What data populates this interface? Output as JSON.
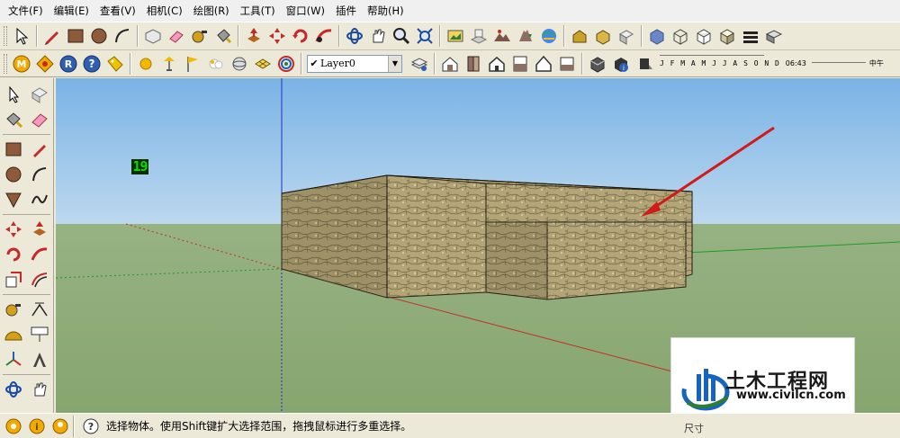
{
  "menu": [
    "文件(F)",
    "编辑(E)",
    "查看(V)",
    "相机(C)",
    "绘图(R)",
    "工具(T)",
    "窗口(W)",
    "插件",
    "帮助(H)"
  ],
  "layers": {
    "check": "✔",
    "current": "Layer0"
  },
  "shadow": {
    "months": "J F M A M J J A S O N D",
    "time": "06:43",
    "noon": "中午"
  },
  "counter": "19",
  "status": {
    "hint": "选择物体。使用Shift键扩大选择范围，拖拽鼠标进行多重选择。",
    "measure_label": "尺寸"
  },
  "watermark": {
    "title": "土木工程网",
    "url": "www.civilcn.com"
  },
  "colors": {
    "sky": "#8fbfe5",
    "ground": "#8eab78",
    "stone": "#b2a376",
    "arrow": "#d11a1a",
    "axis_red": "#c0302a",
    "axis_green": "#1aa020",
    "axis_blue": "#2030c0"
  },
  "icons": {
    "toolbar1": [
      "select-icon",
      "pencil-icon",
      "rectangle-icon",
      "circle-icon",
      "arc-icon",
      "make-component-icon",
      "eraser-icon",
      "tape-measure-icon",
      "paint-bucket-icon",
      "push-pull-icon",
      "move-icon",
      "rotate-icon",
      "follow-me-icon",
      "orbit-icon",
      "pan-icon",
      "zoom-icon",
      "zoom-extents-icon",
      "photo-textures-icon",
      "add-location-icon",
      "toggle-terrain-icon",
      "get-models-icon",
      "share-model-icon",
      "warehouse-icon",
      "iso-view-icon",
      "top-view-icon",
      "front-view-icon",
      "right-view-icon",
      "back-view-icon",
      "left-view-icon",
      "xray-icon",
      "wireframe-icon",
      "hidden-line-icon",
      "shaded-icon",
      "textured-icon"
    ],
    "toolbar2": [
      "ruby-console-icon",
      "plugin-icon",
      "register-icon",
      "help-icon",
      "tag-icon",
      "sun-icon",
      "light-icon",
      "flag-icon",
      "cloud-icon",
      "sphere-icon",
      "grid-icon",
      "spiral-icon",
      "layer-manager-icon",
      "house-icon",
      "door-icon",
      "house-outline-icon",
      "window-icon",
      "house-roof-icon",
      "window-frame-icon",
      "shadow-settings-icon",
      "shadow-info-icon",
      "display-shadows-icon"
    ],
    "left": [
      "select-icon",
      "make-component-icon",
      "paint-bucket-icon",
      "eraser-icon",
      "rectangle-icon",
      "pencil-icon",
      "circle-icon",
      "arc-icon",
      "polygon-icon",
      "freehand-icon",
      "move-icon",
      "push-pull-icon",
      "rotate-icon",
      "follow-me-icon",
      "scale-icon",
      "offset-icon",
      "tape-measure-icon",
      "dimension-icon",
      "protractor-icon",
      "text-icon",
      "axes-icon",
      "3d-text-icon",
      "orbit-icon",
      "pan-icon"
    ],
    "status": [
      "geolocation-icon",
      "credits-icon",
      "user-icon",
      "help-icon"
    ]
  }
}
